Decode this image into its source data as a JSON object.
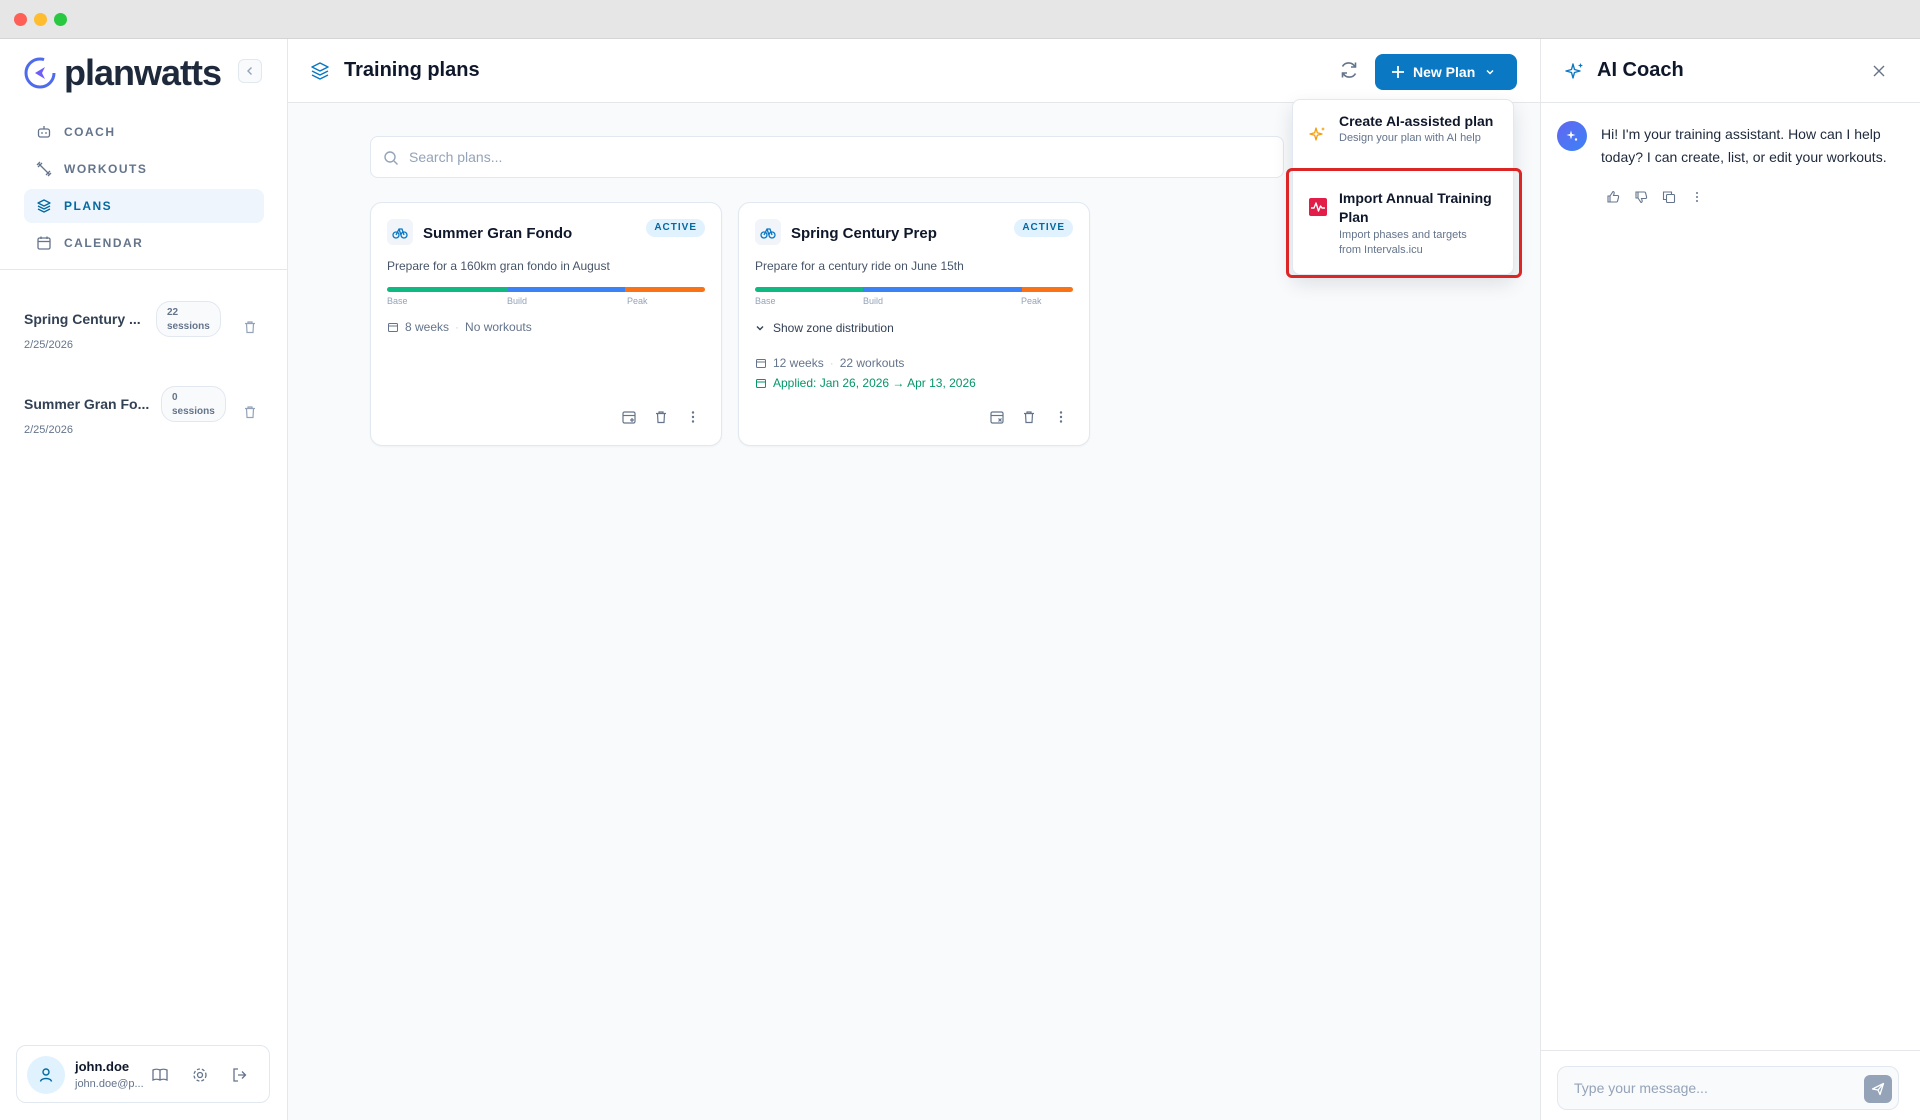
{
  "app": {
    "name": "planwatts"
  },
  "sidebar": {
    "nav": [
      {
        "label": "COACH",
        "icon": "robot-icon"
      },
      {
        "label": "WORKOUTS",
        "icon": "dumbbell-icon"
      },
      {
        "label": "PLANS",
        "icon": "layers-icon",
        "active": true
      },
      {
        "label": "CALENDAR",
        "icon": "calendar-icon"
      }
    ],
    "plans": [
      {
        "title": "Spring Century ...",
        "badge_count": "22",
        "badge_unit": "sessions",
        "date": "2/25/2026"
      },
      {
        "title": "Summer Gran Fo...",
        "badge_count": "0",
        "badge_unit": "sessions",
        "date": "2/25/2026"
      }
    ],
    "user": {
      "name": "john.doe",
      "email": "john.doe@p..."
    }
  },
  "header": {
    "title": "Training plans",
    "new_plan_label": "New Plan"
  },
  "search": {
    "placeholder": "Search plans..."
  },
  "cards": [
    {
      "title": "Summer Gran Fondo",
      "status": "ACTIVE",
      "description": "Prepare for a 160km gran fondo in August",
      "zones": {
        "base": "Base",
        "build": "Build",
        "peak": "Peak"
      },
      "weeks": "8 weeks",
      "workouts": "No workouts"
    },
    {
      "title": "Spring Century Prep",
      "status": "ACTIVE",
      "description": "Prepare for a century ride on June 15th",
      "zones": {
        "base": "Base",
        "build": "Build",
        "peak": "Peak"
      },
      "zone_toggle": "Show zone distribution",
      "weeks": "12 weeks",
      "workouts": "22 workouts",
      "applied": "Applied: Jan 26, 2026 → Apr 13, 2026"
    }
  ],
  "dropdown": {
    "items": [
      {
        "title": "Create AI-assisted plan",
        "subtitle": "Design your plan with AI help",
        "icon": "sparkles-icon"
      },
      {
        "title": "Import Annual Training Plan",
        "subtitle": "Import phases and targets from Intervals.icu",
        "icon": "intervals-logo-icon"
      }
    ]
  },
  "coach": {
    "title": "AI Coach",
    "message": "Hi! I'm your training assistant. How can I help today? I can create, list, or edit your workouts.",
    "input_placeholder": "Type your message..."
  },
  "colors": {
    "primary": "#0a78c2",
    "zone_base": "#10b981",
    "zone_build": "#3b82f6",
    "zone_peak": "#f97316",
    "highlight": "#dc2626"
  }
}
